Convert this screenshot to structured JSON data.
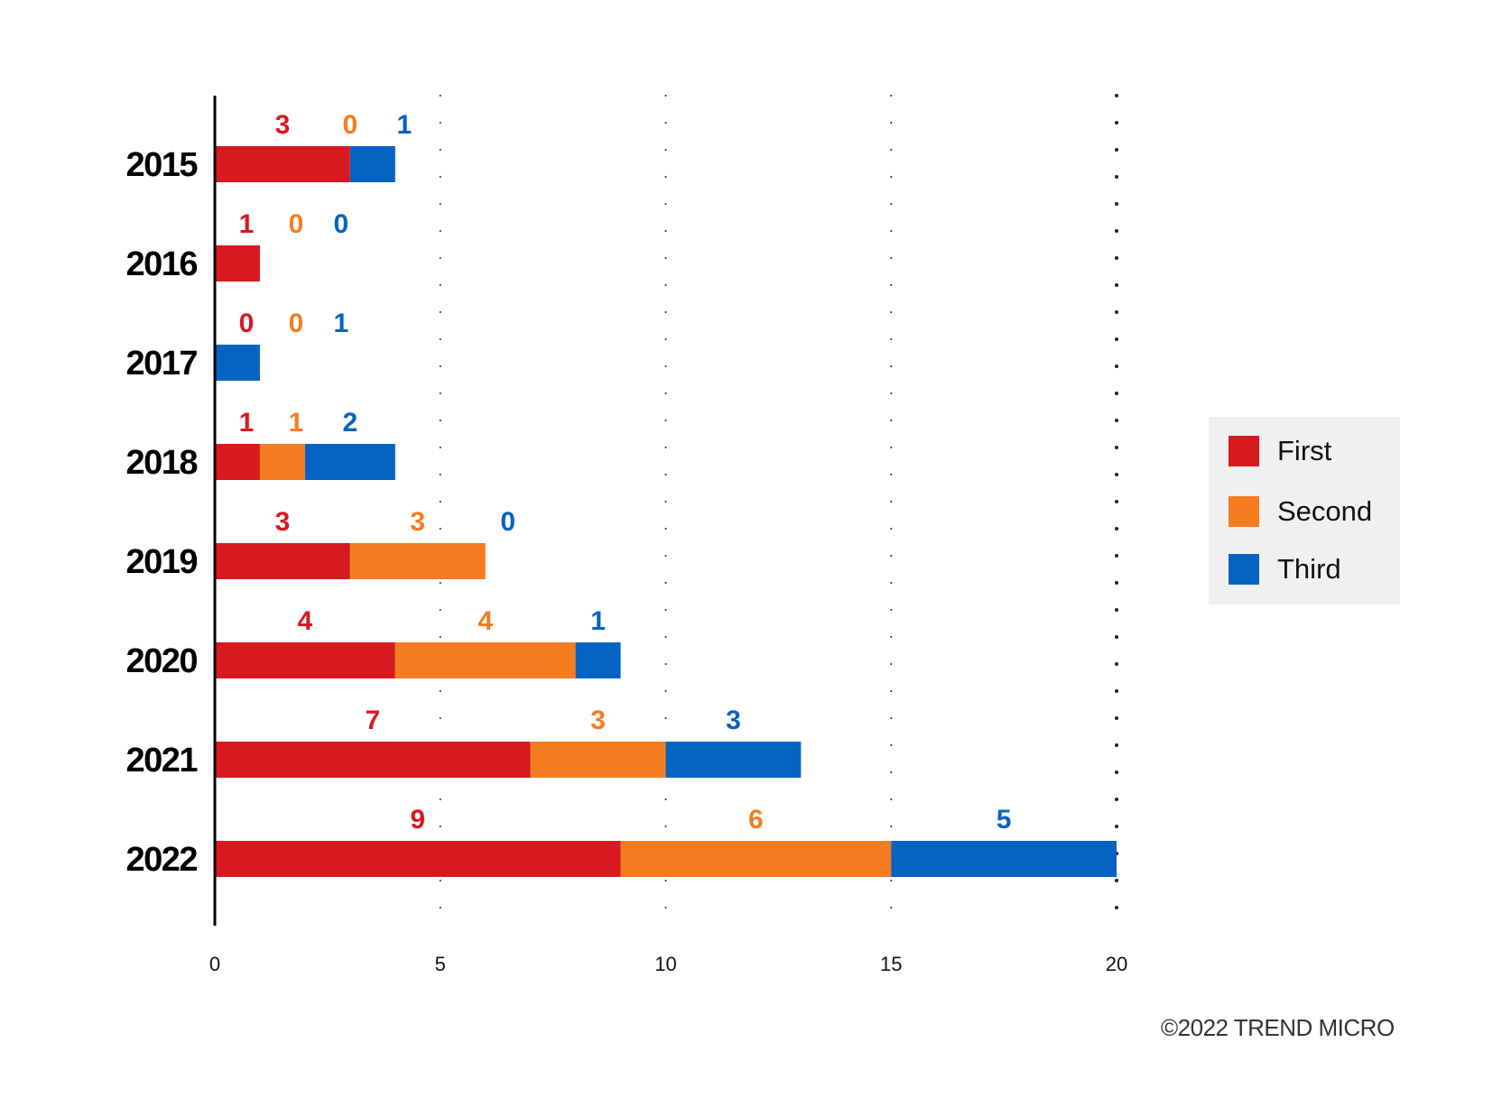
{
  "chart_data": {
    "type": "bar",
    "orientation": "horizontal",
    "stacked": true,
    "title": "",
    "xlabel": "",
    "ylabel": "",
    "categories": [
      "2015",
      "2016",
      "2017",
      "2018",
      "2019",
      "2020",
      "2021",
      "2022"
    ],
    "series": [
      {
        "name": "First",
        "color": "#d71920",
        "values": [
          3,
          1,
          0,
          1,
          3,
          4,
          7,
          9
        ]
      },
      {
        "name": "Second",
        "color": "#f47c20",
        "values": [
          0,
          0,
          0,
          1,
          3,
          4,
          3,
          6
        ]
      },
      {
        "name": "Third",
        "color": "#0563c1",
        "values": [
          1,
          0,
          1,
          2,
          0,
          1,
          3,
          5
        ]
      }
    ],
    "xlim": [
      0,
      20
    ],
    "xticks": [
      "0",
      "5",
      "10",
      "15",
      "20"
    ],
    "grid": "vertical dotted",
    "data_labels": "above each bar, one per series",
    "legend_position": "right"
  },
  "legend": {
    "items": [
      {
        "label": "First",
        "color": "#d71920"
      },
      {
        "label": "Second",
        "color": "#f47c20"
      },
      {
        "label": "Third",
        "color": "#0563c1"
      }
    ]
  },
  "footer": {
    "copyright": "©2022 TREND MICRO"
  }
}
